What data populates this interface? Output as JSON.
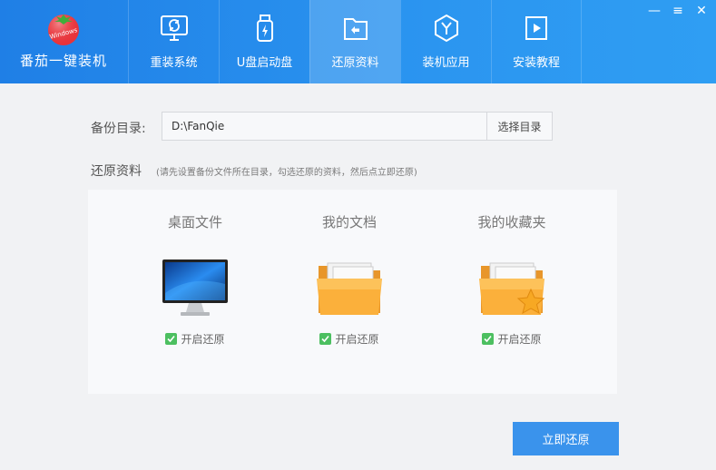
{
  "app": {
    "name": "番茄一键装机",
    "logo_text": "Windows"
  },
  "tabs": [
    {
      "label": "重装系统",
      "icon": "monitor-refresh-icon"
    },
    {
      "label": "U盘启动盘",
      "icon": "usb-bolt-icon"
    },
    {
      "label": "还原资料",
      "icon": "folder-undo-icon",
      "active": true
    },
    {
      "label": "装机应用",
      "icon": "app-y-icon"
    },
    {
      "label": "安装教程",
      "icon": "book-play-icon"
    }
  ],
  "window_controls": {
    "minimize": "—",
    "restore": "≡",
    "close": "✕"
  },
  "backup": {
    "label": "备份目录:",
    "path": "D:\\FanQie",
    "choose_button": "选择目录"
  },
  "restore_section": {
    "title": "还原资料",
    "hint": "(请先设置备份文件所在目录，勾选还原的资料，然后点立即还原)",
    "items": [
      {
        "title": "桌面文件",
        "icon": "desktop-monitor-icon",
        "check_label": "开启还原",
        "checked": true
      },
      {
        "title": "我的文档",
        "icon": "documents-folder-icon",
        "check_label": "开启还原",
        "checked": true
      },
      {
        "title": "我的收藏夹",
        "icon": "favorites-folder-icon",
        "check_label": "开启还原",
        "checked": true
      }
    ]
  },
  "actions": {
    "restore_now": "立即还原"
  },
  "colors": {
    "header": "#2b8ff0",
    "primary_button": "#3a93ec",
    "checkbox": "#4cbf60"
  }
}
